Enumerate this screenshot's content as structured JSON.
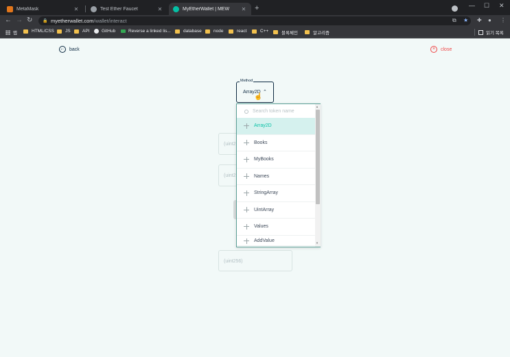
{
  "browser": {
    "tabs": [
      {
        "title": "MetaMask",
        "favicon_color": "#e2761b",
        "active": false
      },
      {
        "title": "Test Ether Faucet",
        "favicon_color": "#9aa0a6",
        "active": false
      },
      {
        "title": "MyEtherWallet | MEW",
        "favicon_color": "#05c0a5",
        "active": true
      }
    ],
    "new_tab_label": "+",
    "address": {
      "host": "myetherwallet.com",
      "path": "/wallet/interact"
    },
    "bookmarks": [
      {
        "label": "앱",
        "kind": "apps"
      },
      {
        "label": "HTML/CSS",
        "kind": "folder"
      },
      {
        "label": "JS",
        "kind": "folder"
      },
      {
        "label": "API",
        "kind": "folder"
      },
      {
        "label": "GitHub",
        "kind": "github"
      },
      {
        "label": "Reverse a linked lis...",
        "kind": "link"
      },
      {
        "label": "database",
        "kind": "folder"
      },
      {
        "label": "node",
        "kind": "folder"
      },
      {
        "label": "react",
        "kind": "folder"
      },
      {
        "label": "C++",
        "kind": "folder"
      },
      {
        "label": "블록체인",
        "kind": "folder"
      },
      {
        "label": "알고리즘",
        "kind": "folder"
      }
    ],
    "reading_list": "읽기 목록"
  },
  "page": {
    "back_label": "back",
    "close_label": "close",
    "method": {
      "legend": "Method",
      "value": "Array2D"
    },
    "ghost_fields": [
      "(uint2",
      "(uint2",
      "(uint256)"
    ],
    "dropdown": {
      "search_placeholder": "Search token name",
      "items": [
        "Array2D",
        "Books",
        "MyBooks",
        "Names",
        "StringArray",
        "UintArray",
        "Values",
        "AddValue"
      ],
      "selected": "Array2D"
    }
  },
  "colors": {
    "accent": "#05c0a5",
    "navy": "#0b2840",
    "danger": "#ef4444",
    "page_bg": "#f2f9f8"
  }
}
